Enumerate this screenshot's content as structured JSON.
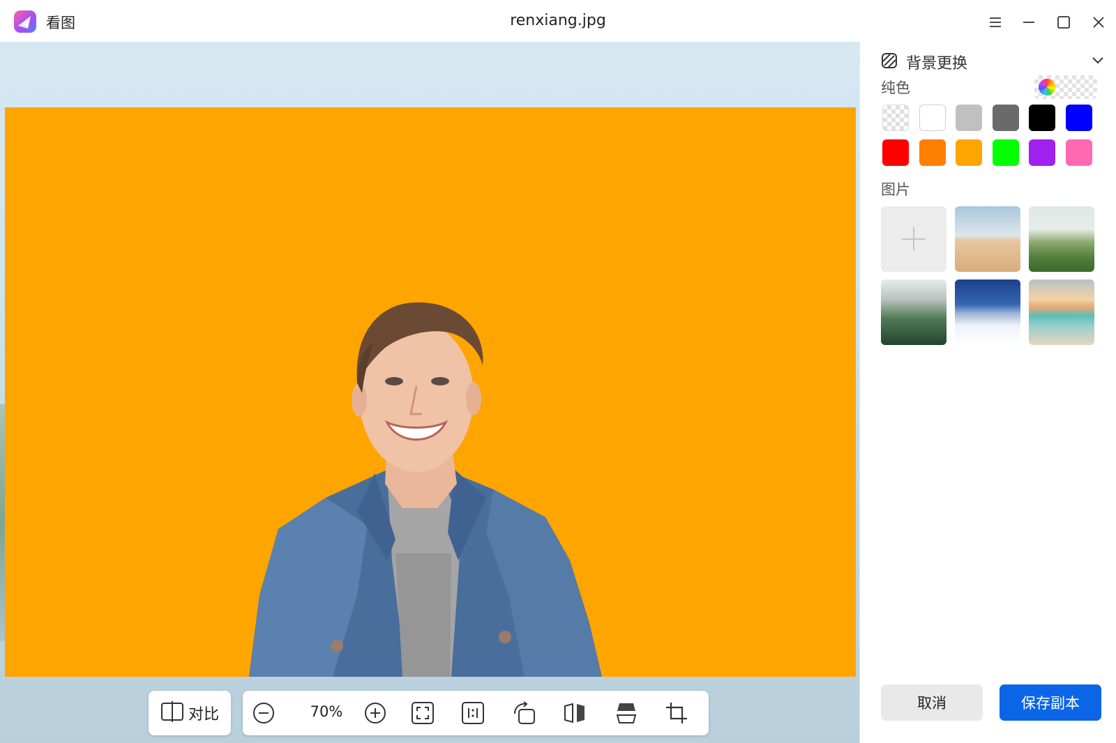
{
  "app": {
    "name": "看图",
    "file_title": "renxiang.jpg"
  },
  "window_controls": [
    "menu-icon",
    "minimize-icon",
    "maximize-icon",
    "close-icon"
  ],
  "toolbar": {
    "compare_label": "对比",
    "zoom_value": "70%",
    "icons": [
      "zoom-out-icon",
      "zoom-in-icon",
      "fit-window-icon",
      "actual-size-icon",
      "rotate-icon",
      "flip-horizontal-icon",
      "flip-vertical-icon",
      "crop-icon"
    ]
  },
  "image": {
    "background_color": "#ffa500"
  },
  "panel": {
    "title": "背景更换",
    "solid_label": "纯色",
    "colors": [
      {
        "name": "transparent",
        "hex": "transparent"
      },
      {
        "name": "white",
        "hex": "#ffffff"
      },
      {
        "name": "light-gray",
        "hex": "#c0c0c0"
      },
      {
        "name": "dark-gray",
        "hex": "#6a6a6a"
      },
      {
        "name": "black",
        "hex": "#000000"
      },
      {
        "name": "blue",
        "hex": "#0000ff"
      },
      {
        "name": "red",
        "hex": "#ff0000"
      },
      {
        "name": "dark-orange",
        "hex": "#ff8000"
      },
      {
        "name": "orange",
        "hex": "#ffa500"
      },
      {
        "name": "green",
        "hex": "#00ff00"
      },
      {
        "name": "purple",
        "hex": "#a020f0"
      },
      {
        "name": "pink",
        "hex": "#ff69b4"
      }
    ],
    "image_label": "图片",
    "backgrounds": [
      "add",
      "desert",
      "green-hills",
      "misty-forest",
      "snow-mountain",
      "beach-sunset"
    ],
    "cancel_label": "取消",
    "save_label": "保存副本"
  },
  "accent_color": "#0a66e6"
}
